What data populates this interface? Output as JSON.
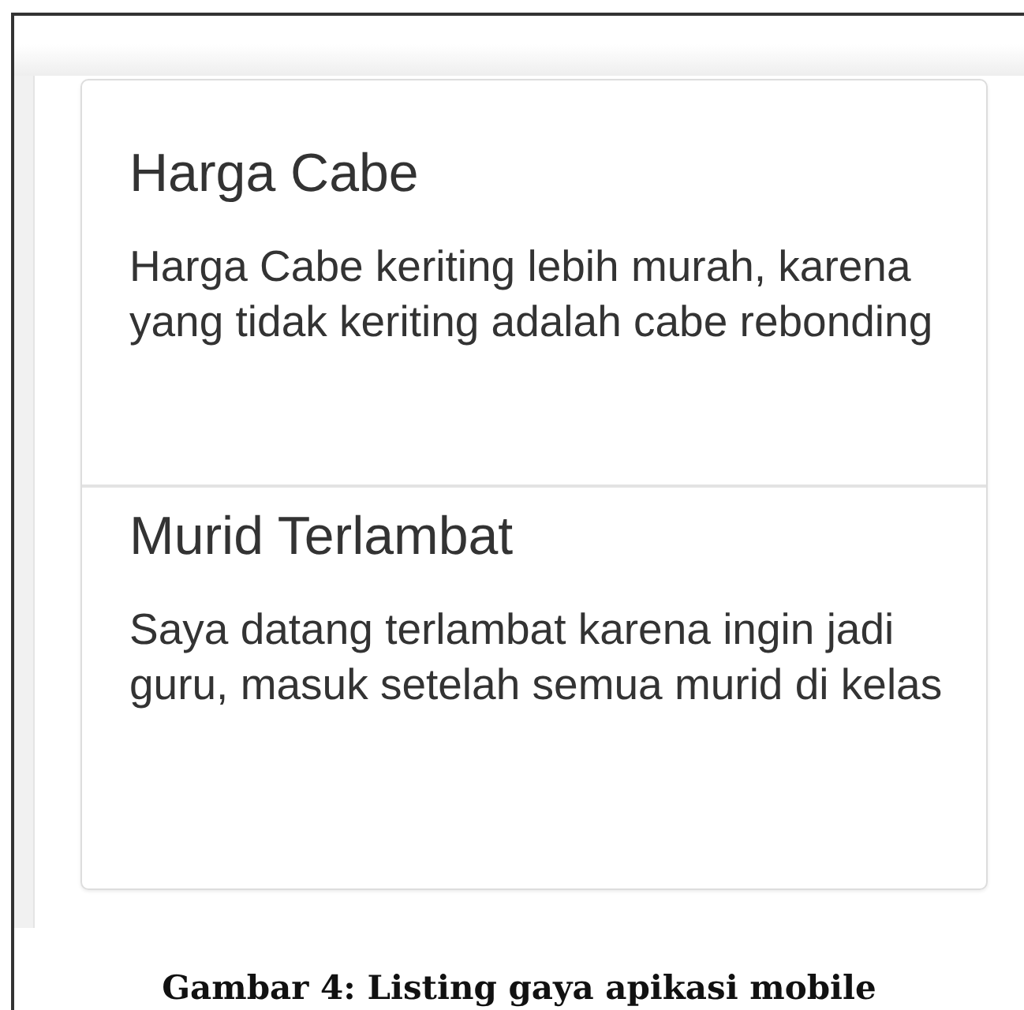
{
  "items": [
    {
      "title": "Harga Cabe",
      "text": "Harga Cabe keriting lebih murah, karena yang tidak keriting adalah cabe rebonding"
    },
    {
      "title": "Murid Terlambat",
      "text": "Saya datang terlambat karena ingin jadi guru, masuk setelah semua murid di kelas"
    }
  ],
  "caption": "Gambar 4: Listing gaya apikasi mobile"
}
